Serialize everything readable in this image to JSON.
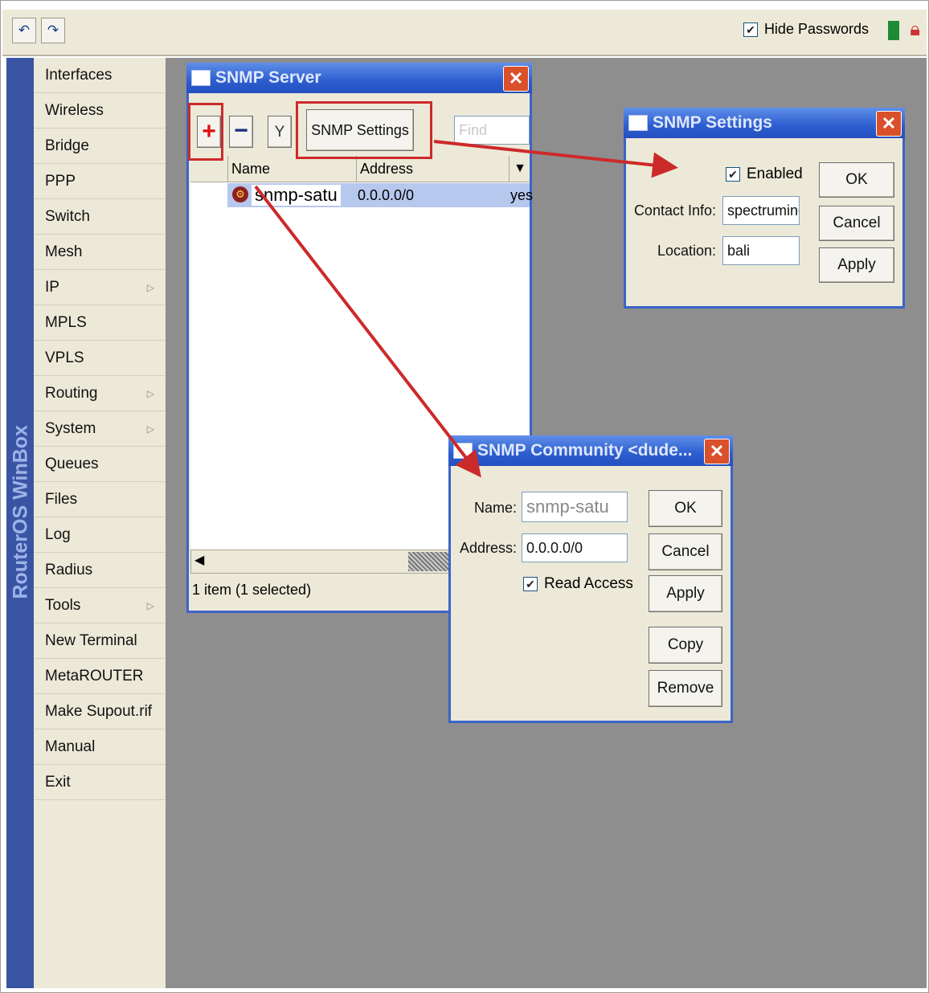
{
  "toolbar": {
    "undo_icon": "undo-icon",
    "redo_icon": "redo-icon",
    "hide_passwords_checked": "✔",
    "hide_passwords_label": "Hide Passwords"
  },
  "side_strip": {
    "brand": "RouterOS WinBox"
  },
  "menu": {
    "items": [
      {
        "label": "Interfaces"
      },
      {
        "label": "Wireless"
      },
      {
        "label": "Bridge"
      },
      {
        "label": "PPP"
      },
      {
        "label": "Switch"
      },
      {
        "label": "Mesh"
      },
      {
        "label": "IP",
        "submenu": "▷"
      },
      {
        "label": "MPLS"
      },
      {
        "label": "VPLS"
      },
      {
        "label": "Routing",
        "submenu": "▷"
      },
      {
        "label": "System",
        "submenu": "▷"
      },
      {
        "label": "Queues"
      },
      {
        "label": "Files"
      },
      {
        "label": "Log"
      },
      {
        "label": "Radius"
      },
      {
        "label": "Tools",
        "submenu": "▷"
      },
      {
        "label": "New Terminal"
      },
      {
        "label": "MetaROUTER"
      },
      {
        "label": "Make Supout.rif"
      },
      {
        "label": "Manual"
      },
      {
        "label": "Exit"
      }
    ]
  },
  "snmp_server": {
    "title": "SNMP Server",
    "add_label": "+",
    "remove_label": "−",
    "filter_label": "Y",
    "settings_label": "SNMP Settings",
    "find_placeholder": "Find",
    "columns": [
      "Name",
      "Address",
      "▼"
    ],
    "row": {
      "name": "snmp-satu",
      "address": "0.0.0.0/0",
      "read": "yes"
    },
    "status": "1 item (1 selected)"
  },
  "snmp_settings": {
    "title": "SNMP Settings",
    "enabled_checked": "✔",
    "enabled_label": "Enabled",
    "contact_label": "Contact Info:",
    "contact_value": "spectrumind",
    "location_label": "Location:",
    "location_value": "bali",
    "ok": "OK",
    "cancel": "Cancel",
    "apply": "Apply"
  },
  "snmp_community": {
    "title": "SNMP Community <dude...",
    "name_label": "Name:",
    "name_value": "snmp-satu",
    "address_label": "Address:",
    "address_value": "0.0.0.0/0",
    "read_access_checked": "✔",
    "read_access_label": "Read Access",
    "ok": "OK",
    "cancel": "Cancel",
    "apply": "Apply",
    "copy": "Copy",
    "remove": "Remove"
  },
  "colors": {
    "titlebar": "#2c5dcf",
    "desktop": "#8e8e8e",
    "highlight": "#cc2a2a",
    "selected_row": "#b7c8ee"
  }
}
